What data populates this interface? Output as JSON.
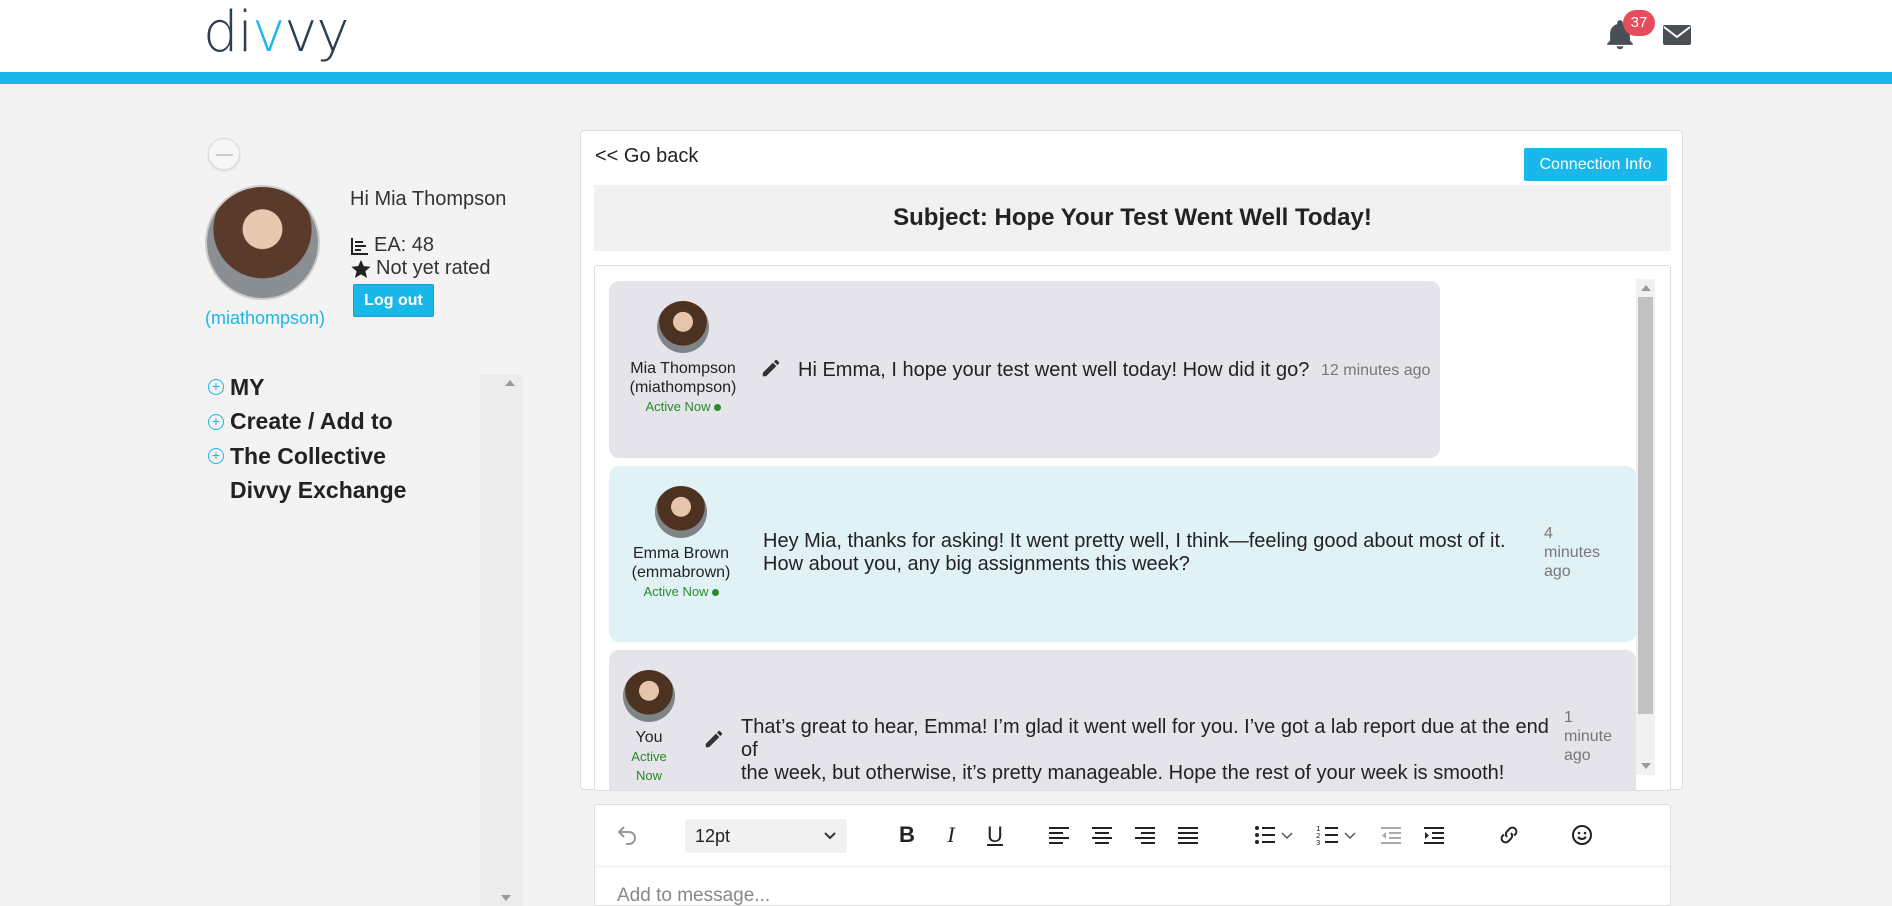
{
  "header": {
    "logo_prefix": "di",
    "logo_v1": "v",
    "logo_v2": "v",
    "logo_suffix": "y",
    "notification_count": "37",
    "accent_color": "#1ab7ea",
    "icons": [
      "bell-icon",
      "envelope-icon"
    ]
  },
  "profile": {
    "greeting": "Hi Mia Thompson",
    "username": "(miathompson)",
    "ea": "EA: 48",
    "rating": "Not yet rated",
    "logout_label": "Log out"
  },
  "nav": {
    "items": [
      {
        "label": "MY",
        "icon": "plus-circle-icon"
      },
      {
        "label": "Create / Add to",
        "icon": "plus-circle-icon"
      },
      {
        "label": "The Collective",
        "icon": "plus-circle-icon"
      },
      {
        "label": "Divvy Exchange",
        "icon": ""
      }
    ]
  },
  "conversation": {
    "go_back": "<< Go back",
    "connection_info": "Connection Info",
    "subject": "Subject: Hope Your Test Went Well Today!",
    "messages": [
      {
        "sender_name": "Mia Thompson",
        "sender_handle": "(miathompson)",
        "status": "Active Now",
        "text": "Hi Emma, I hope your test went well today! How did it go?",
        "time": "12 minutes ago",
        "editable": true
      },
      {
        "sender_name": "Emma Brown",
        "sender_handle": "(emmabrown)",
        "status": "Active Now",
        "text_line1": "Hey Mia, thanks for asking! It went pretty well, I think—feeling good about most of it.",
        "text_line2": "How about you, any big assignments this week?",
        "time_line1": "4",
        "time_line2": "minutes",
        "time_line3": "ago",
        "editable": false
      },
      {
        "sender_name": "You",
        "status_line1": "Active",
        "status_line2": "Now",
        "text_line1": "That’s great to hear, Emma! I’m glad it went well for you. I’ve got a lab report due at the end of",
        "text_line2": "the week, but otherwise, it’s pretty manageable. Hope the rest of your week is smooth!",
        "time_line1": "1",
        "time_line2": "minute",
        "time_line3": "ago",
        "editable": true
      }
    ]
  },
  "editor": {
    "font_size": "12pt",
    "placeholder": "Add to message...",
    "toolbar_icons": [
      "undo-icon",
      "bold-icon",
      "italic-icon",
      "underline-icon",
      "align-left-icon",
      "align-center-icon",
      "align-right-icon",
      "align-justify-icon",
      "bullet-list-icon",
      "numbered-list-icon",
      "outdent-icon",
      "indent-icon",
      "link-icon",
      "emoji-icon"
    ],
    "bold_glyph": "B",
    "italic_glyph": "I",
    "underline_glyph": "U"
  }
}
